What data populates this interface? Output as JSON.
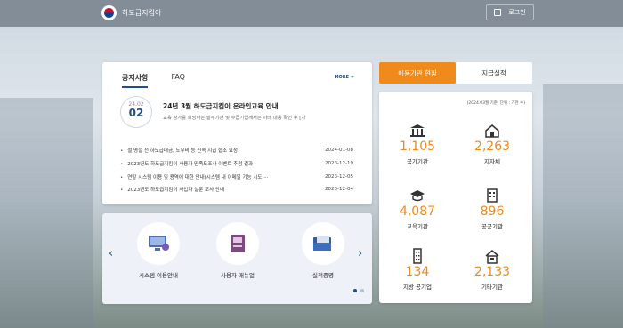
{
  "header": {
    "site_name": "하도급지킴이",
    "login_label": "로그인"
  },
  "notice_panel": {
    "tabs": [
      "공지사항",
      "FAQ"
    ],
    "more_label": "MORE",
    "featured": {
      "month": "24.02",
      "day": "02",
      "title": "24년 3월 하도급지킴이 온라인교육 안내",
      "desc": "교육 참가를 희망하는 발주기관 및 수급기업께서는 아래 내용 확인 후 [가"
    },
    "items": [
      {
        "title": "설 명절 전 하도급대금, 노무비 등 신속 지급 협조 요청",
        "date": "2024-01-08"
      },
      {
        "title": "2023년도 하도급지킴이 사용자 만족도조사 이벤트 추첨 결과",
        "date": "2023-12-19"
      },
      {
        "title": "연말 시스템 이용 및 용역에 대한 안내(시스템 내 이메일 기능 시도 ···",
        "date": "2023-12-05"
      },
      {
        "title": "2023년도 하도급지킴이 사업자 실문 조사 안내",
        "date": "2023-12-04"
      }
    ]
  },
  "quick_menu": {
    "items": [
      {
        "label": "시스템 이용안내",
        "icon": "monitor-gear-icon"
      },
      {
        "label": "사용자 매뉴얼",
        "icon": "manual-book-icon"
      },
      {
        "label": "실적증명",
        "icon": "certificate-folder-icon"
      }
    ]
  },
  "stats_panel": {
    "tabs": [
      "이용기관 현황",
      "지급실적"
    ],
    "note": "(2024.03월 기준, 단위 : 기관 수)",
    "accent_color": "#ef8a1b",
    "items": [
      {
        "value": "1,105",
        "label": "국가기관",
        "icon": "government-building-icon"
      },
      {
        "value": "2,263",
        "label": "지자체",
        "icon": "house-icon"
      },
      {
        "value": "4,087",
        "label": "교육기관",
        "icon": "graduation-cap-icon"
      },
      {
        "value": "896",
        "label": "공공기관",
        "icon": "office-building-icon"
      },
      {
        "value": "134",
        "label": "지방 공기업",
        "icon": "tower-building-icon"
      },
      {
        "value": "2,133",
        "label": "기타기관",
        "icon": "home-building-icon"
      }
    ]
  }
}
